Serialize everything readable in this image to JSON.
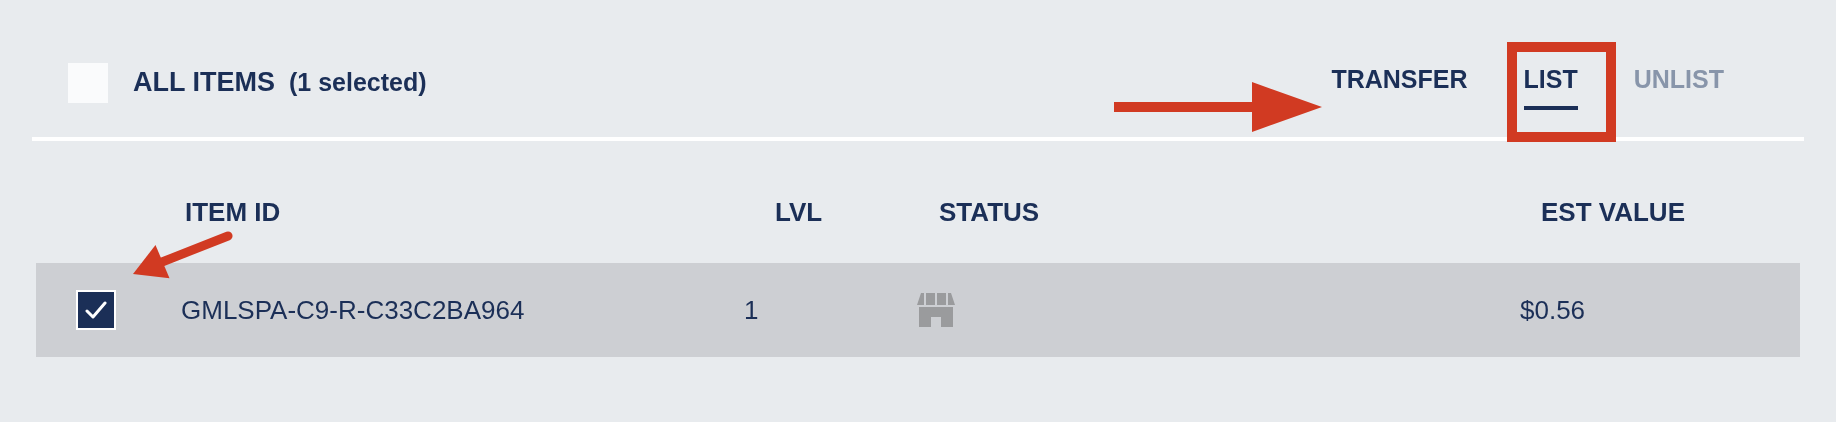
{
  "toolbar": {
    "select_all": {
      "checked": false,
      "label": "ALL ITEMS",
      "count": "(1 selected)"
    },
    "actions": [
      {
        "label": "TRANSFER",
        "selected": false,
        "disabled": false
      },
      {
        "label": "LIST",
        "selected": true,
        "disabled": false
      },
      {
        "label": "UNLIST",
        "selected": false,
        "disabled": true
      }
    ]
  },
  "table": {
    "columns": [
      "ITEM ID",
      "LVL",
      "STATUS",
      "EST VALUE"
    ],
    "rows": [
      {
        "selected": true,
        "item_id": "GMLSPA-C9-R-C33C2BA964",
        "lvl": "1",
        "est_value": "$0.56"
      }
    ]
  }
}
